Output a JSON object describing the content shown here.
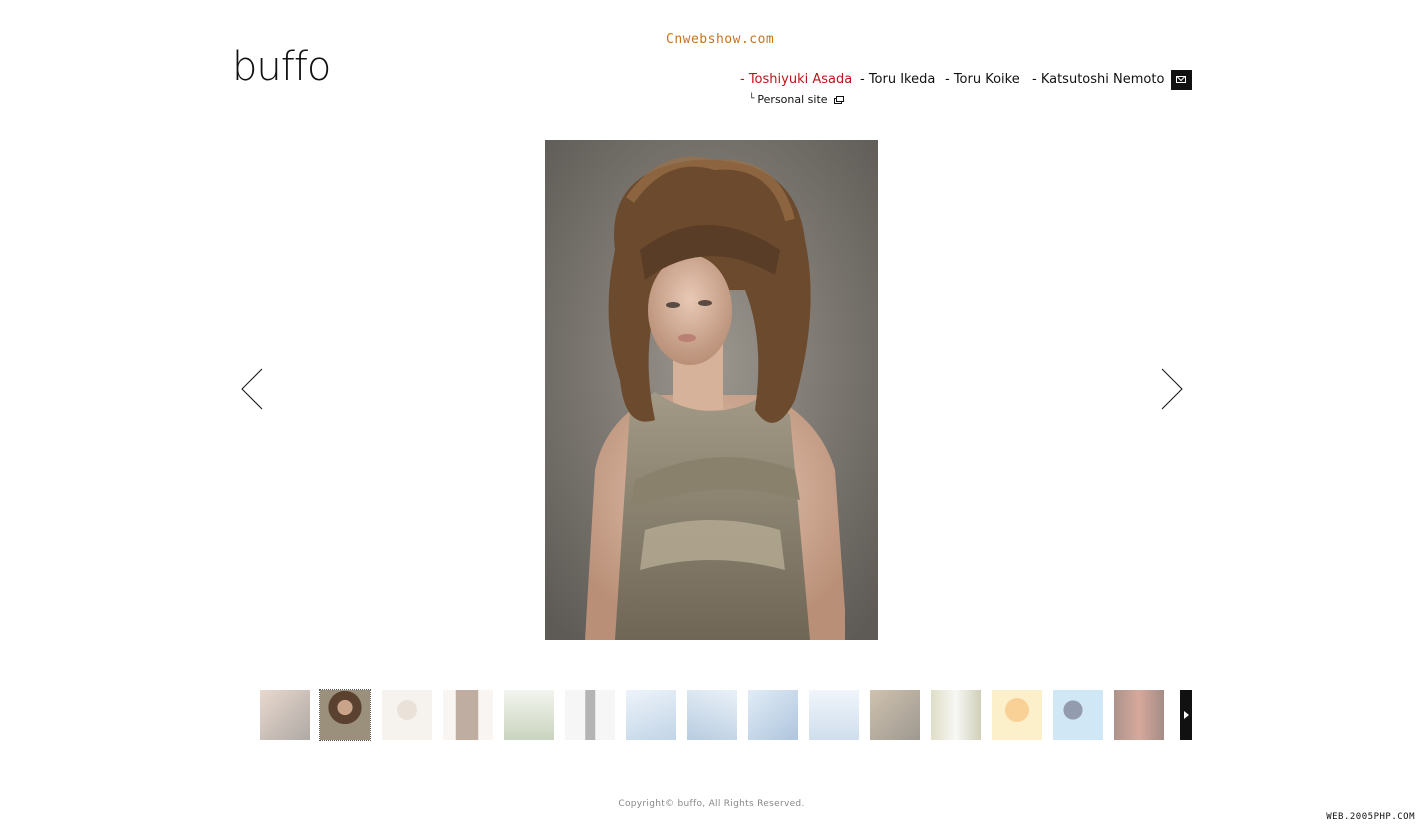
{
  "watermark_top": "Cnwebshow.com",
  "logo": "buffo",
  "nav": {
    "items": [
      {
        "label": "- Toshiyuki Asada",
        "active": true
      },
      {
        "label": "- Toru Ikeda",
        "active": false
      },
      {
        "label": "- Toru Koike",
        "active": false
      },
      {
        "label": "- Katsutoshi Nemoto",
        "active": false
      }
    ],
    "sub_link": "Personal site",
    "active_color": "#b8161b"
  },
  "gallery": {
    "thumbnail_count": 15,
    "selected_index": 1
  },
  "footer": {
    "copyright": "Copyright© buffo, All Rights Reserved.",
    "watermark": "WEB.2005PHP.COM"
  }
}
